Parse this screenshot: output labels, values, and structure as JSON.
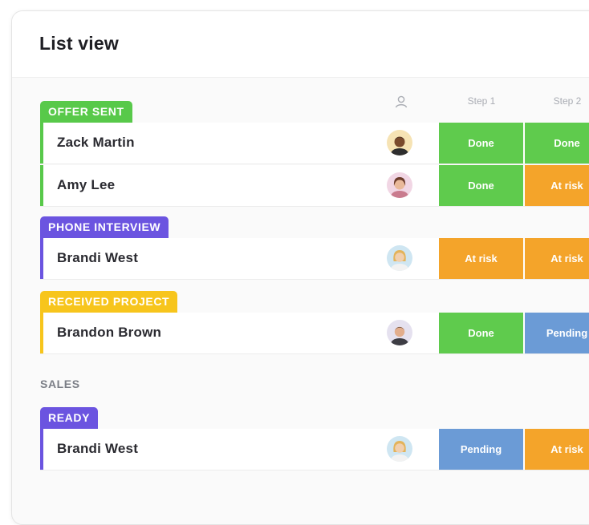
{
  "title": "List view",
  "columns": {
    "step1": "Step 1",
    "step2": "Step 2"
  },
  "colors": {
    "offer_sent": "#58c94a",
    "phone_interview": "#6b54e0",
    "received_project": "#f7c51c",
    "ready": "#6b54e0",
    "done": "#5fcb4d",
    "at_risk": "#f4a42a",
    "pending": "#6b9bd6"
  },
  "groups": {
    "offer_sent": {
      "label": "OFFER SENT",
      "rows": [
        {
          "name": "Zack Martin",
          "step1": "Done",
          "step2": "Done"
        },
        {
          "name": "Amy Lee",
          "step1": "Done",
          "step2": "At risk"
        }
      ]
    },
    "phone_interview": {
      "label": "PHONE INTERVIEW",
      "rows": [
        {
          "name": "Brandi West",
          "step1": "At risk",
          "step2": "At risk"
        }
      ]
    },
    "received_project": {
      "label": "RECEIVED PROJECT",
      "rows": [
        {
          "name": "Brandon Brown",
          "step1": "Done",
          "step2": "Pending"
        }
      ]
    }
  },
  "sections": {
    "sales": {
      "label": "SALES",
      "groups": {
        "ready": {
          "label": "READY",
          "rows": [
            {
              "name": "Brandi West",
              "step1": "Pending",
              "step2": "At risk"
            }
          ]
        }
      }
    }
  }
}
